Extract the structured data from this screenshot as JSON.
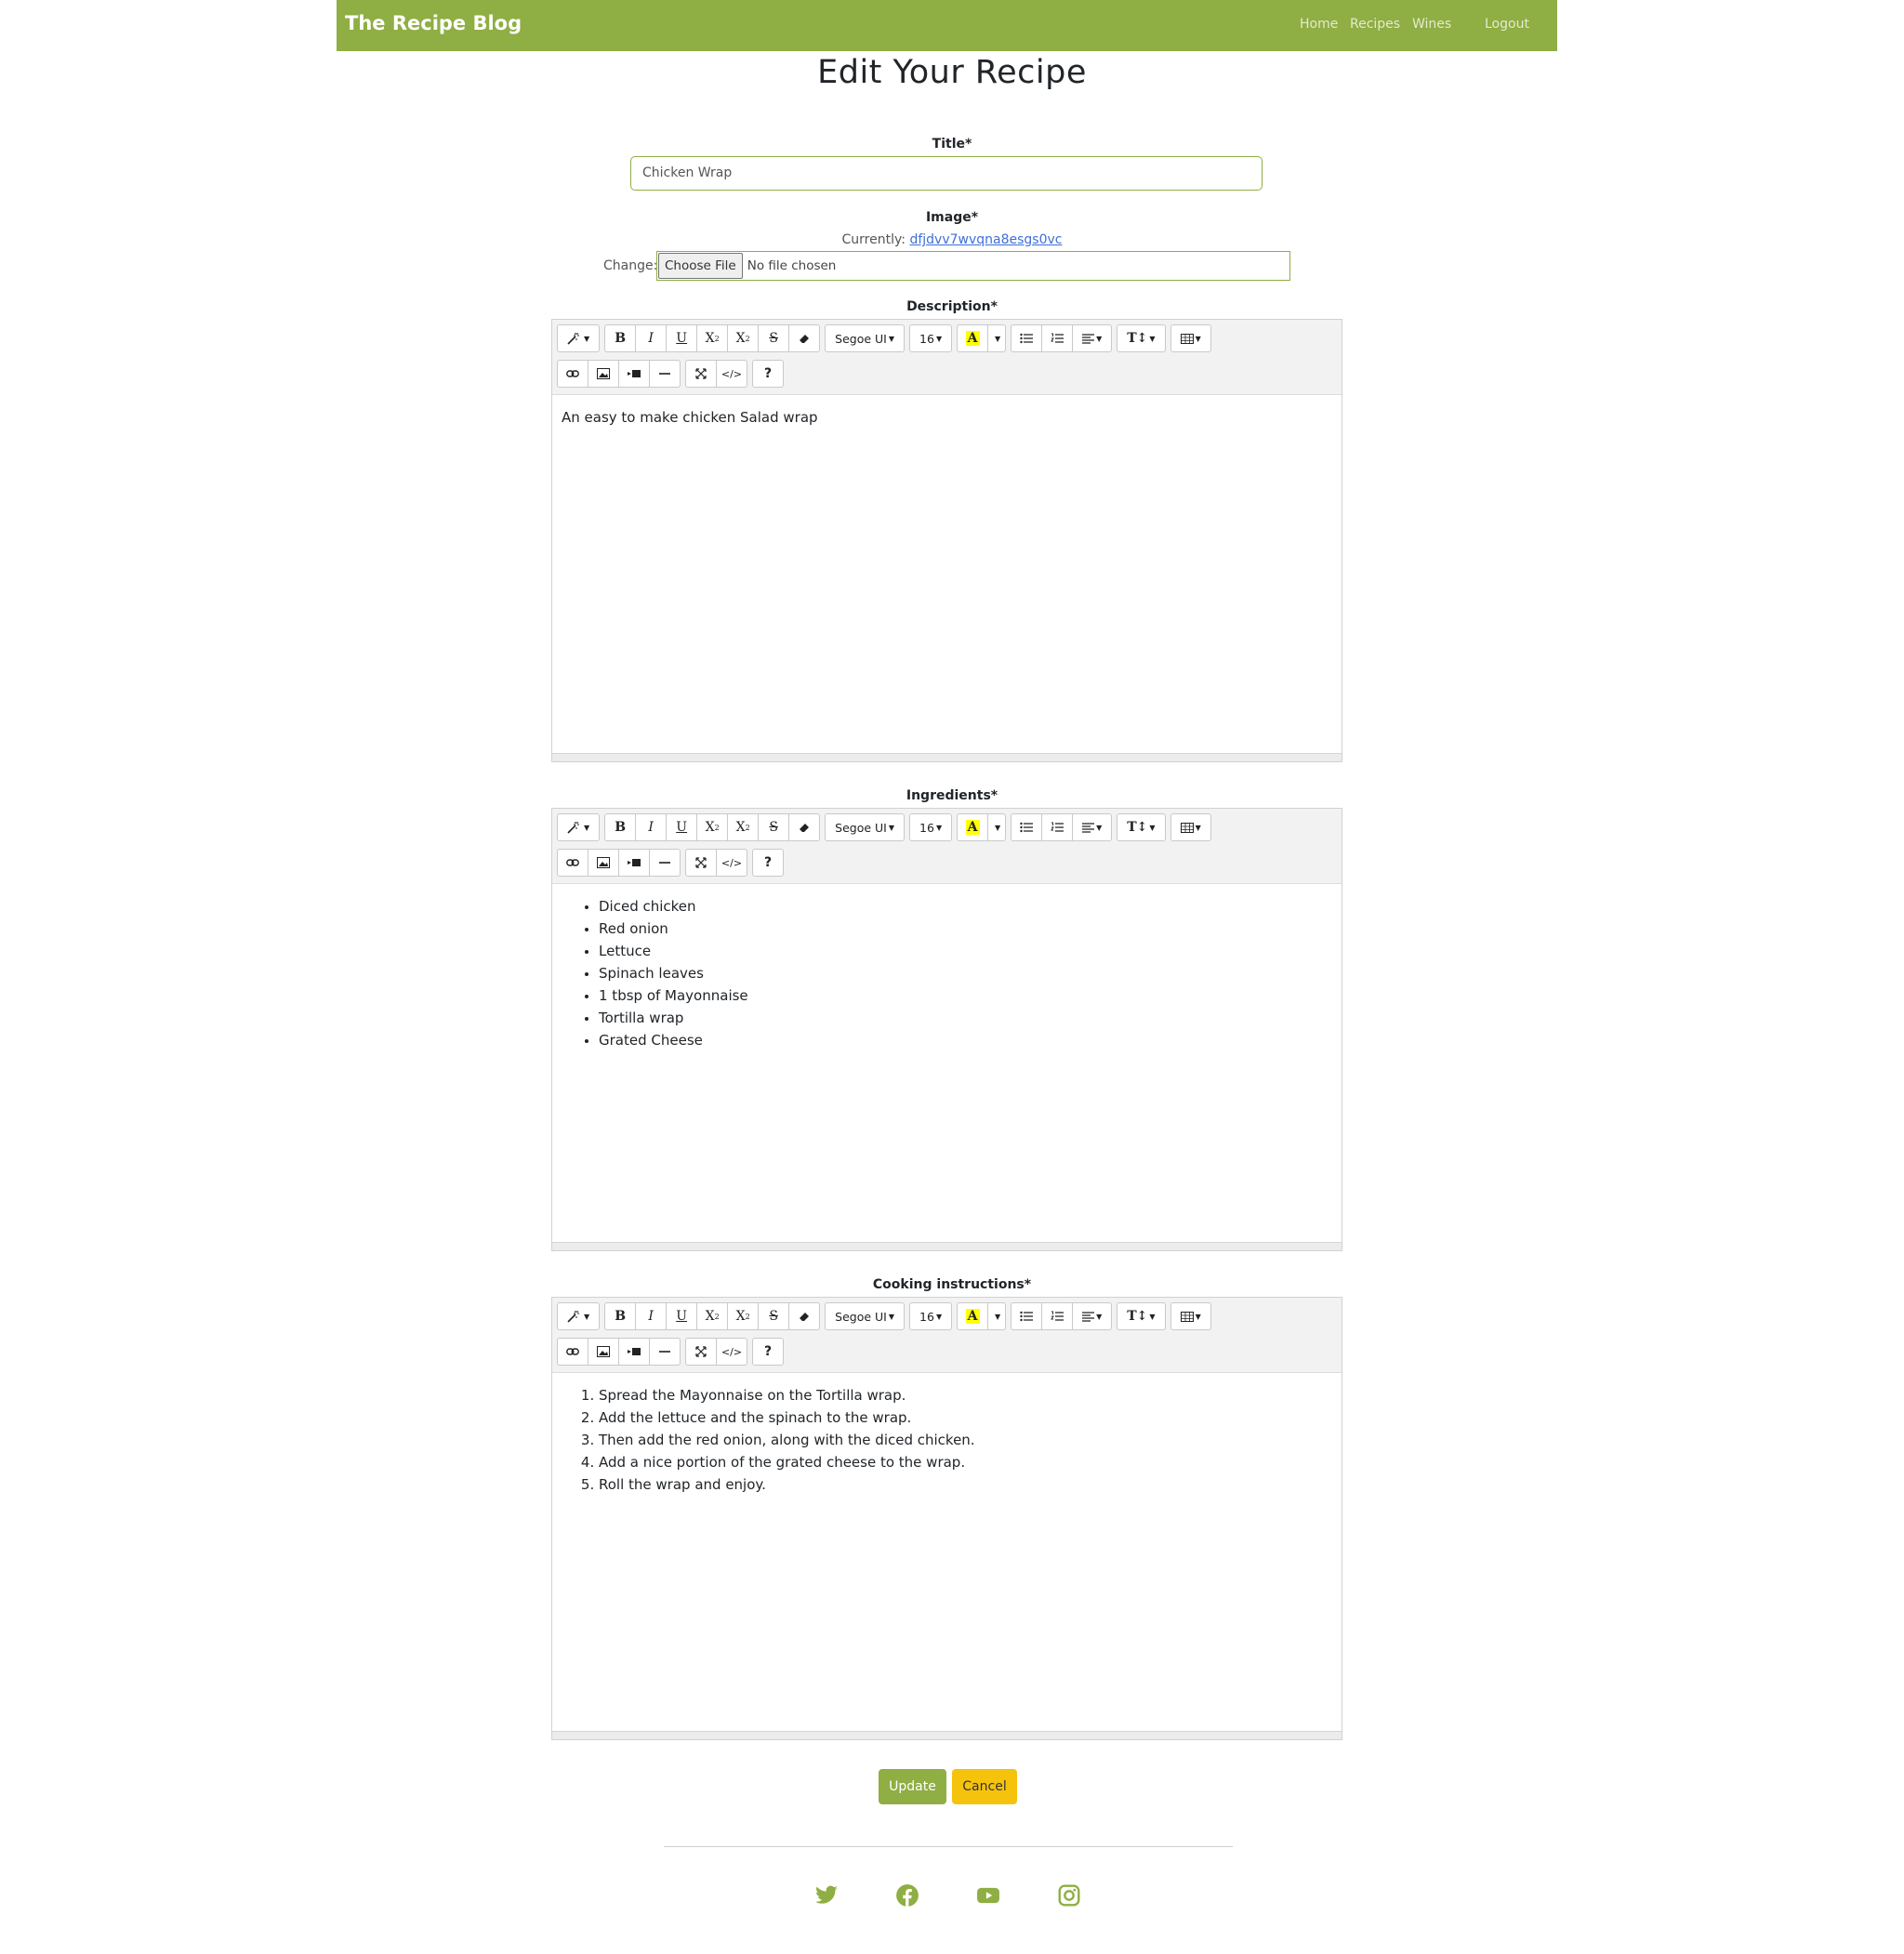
{
  "navbar": {
    "brand": "The Recipe Blog",
    "links": {
      "home": "Home",
      "recipes": "Recipes",
      "wines": "Wines",
      "logout": "Logout"
    }
  },
  "page_title": "Edit Your Recipe",
  "form": {
    "title_label": "Title*",
    "title_value": "Chicken Wrap",
    "image_label": "Image*",
    "currently_label": "Currently:",
    "currently_file": "dfjdvv7wvqna8esgs0vc",
    "change_label": "Change:",
    "choose_file": "Choose File",
    "no_file": "No file chosen",
    "description_label": "Description*",
    "ingredients_label": "Ingredients*",
    "instructions_label": "Cooking instructions*"
  },
  "toolbar": {
    "font_name": "Segoe UI",
    "font_size": "16",
    "color_letter": "A",
    "help": "?"
  },
  "description": {
    "text": "An easy to make chicken Salad wrap"
  },
  "ingredients": {
    "items": [
      "Diced chicken",
      "Red onion",
      "Lettuce",
      "Spinach leaves",
      "1 tbsp of Mayonnaise",
      "Tortilla wrap",
      "Grated Cheese"
    ]
  },
  "instructions": {
    "steps": [
      "Spread the Mayonnaise on the Tortilla wrap.",
      "Add the lettuce and the spinach to the wrap.",
      "Then add the red onion, along with the diced chicken.",
      "Add a nice portion of the grated cheese to the wrap.",
      "Roll the wrap and enjoy."
    ]
  },
  "actions": {
    "update": "Update",
    "cancel": "Cancel"
  },
  "colors": {
    "brand": "#8fae43",
    "cancel": "#f5c30c",
    "link": "#3e6fd8"
  }
}
